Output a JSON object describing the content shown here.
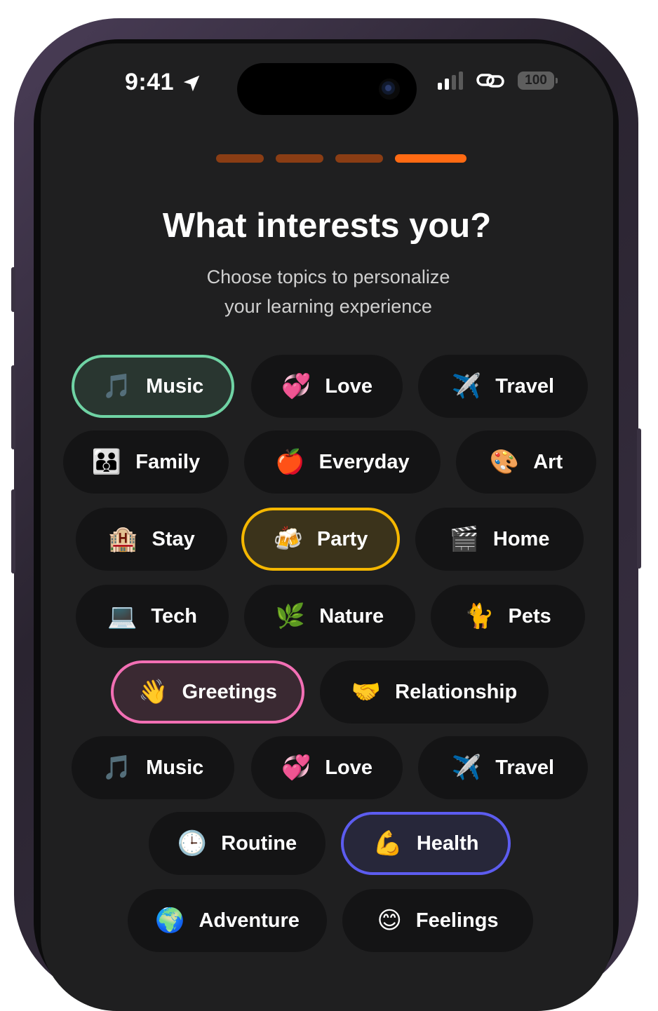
{
  "status_bar": {
    "time": "9:41",
    "battery": "100",
    "location_icon": "location-arrow-icon",
    "signal_icon": "cellular-signal-icon",
    "link_icon": "link-icon"
  },
  "progress": {
    "steps_total": 4,
    "current_step": 4,
    "active_color": "#ff6a13",
    "inactive_color": "#8a3d14"
  },
  "header": {
    "title": "What interests you?",
    "subtitle_line1": "Choose topics to personalize",
    "subtitle_line2": "your learning experience"
  },
  "topics": [
    {
      "label": "Music",
      "icon": "🎵",
      "icon_name": "music-note-icon",
      "selected": true,
      "accent": "#6fd3a4"
    },
    {
      "label": "Love",
      "icon": "💞",
      "icon_name": "hearts-icon",
      "selected": false
    },
    {
      "label": "Travel",
      "icon": "✈️",
      "icon_name": "airplane-icon",
      "selected": false
    },
    {
      "label": "Family",
      "icon": "👪",
      "icon_name": "family-icon",
      "selected": false
    },
    {
      "label": "Everyday",
      "icon": "🍎",
      "icon_name": "apple-icon",
      "selected": false
    },
    {
      "label": "Art",
      "icon": "🎨",
      "icon_name": "palette-icon",
      "selected": false
    },
    {
      "label": "Stay",
      "icon": "🏨",
      "icon_name": "hotel-icon",
      "selected": false
    },
    {
      "label": "Party",
      "icon": "🍻",
      "icon_name": "beer-mugs-icon",
      "selected": true,
      "accent": "#f5b700"
    },
    {
      "label": "Home",
      "icon": "🎬",
      "icon_name": "clapper-board-icon",
      "selected": false
    },
    {
      "label": "Tech",
      "icon": "💻",
      "icon_name": "laptop-icon",
      "selected": false
    },
    {
      "label": "Nature",
      "icon": "🌿",
      "icon_name": "herb-icon",
      "selected": false
    },
    {
      "label": "Pets",
      "icon": "🐈",
      "icon_name": "cat-icon",
      "selected": false
    },
    {
      "label": "Greetings",
      "icon": "👋",
      "icon_name": "waving-hand-icon",
      "selected": true,
      "accent": "#f26fb4"
    },
    {
      "label": "Relationship",
      "icon": "🤝",
      "icon_name": "handshake-icon",
      "selected": false
    },
    {
      "label": "Music",
      "icon": "🎵",
      "icon_name": "music-note-icon",
      "selected": false
    },
    {
      "label": "Love",
      "icon": "💞",
      "icon_name": "hearts-icon",
      "selected": false
    },
    {
      "label": "Travel",
      "icon": "✈️",
      "icon_name": "airplane-icon",
      "selected": false
    },
    {
      "label": "Routine",
      "icon": "🕒",
      "icon_name": "clock-icon",
      "selected": false
    },
    {
      "label": "Health",
      "icon": "💪",
      "icon_name": "flexed-biceps-icon",
      "selected": true,
      "accent": "#5c5cf0"
    },
    {
      "label": "Adventure",
      "icon": "🌍",
      "icon_name": "globe-icon",
      "selected": false
    },
    {
      "label": "Feelings",
      "icon": "😊",
      "icon_name": "smiling-face-icon",
      "selected": false
    }
  ]
}
